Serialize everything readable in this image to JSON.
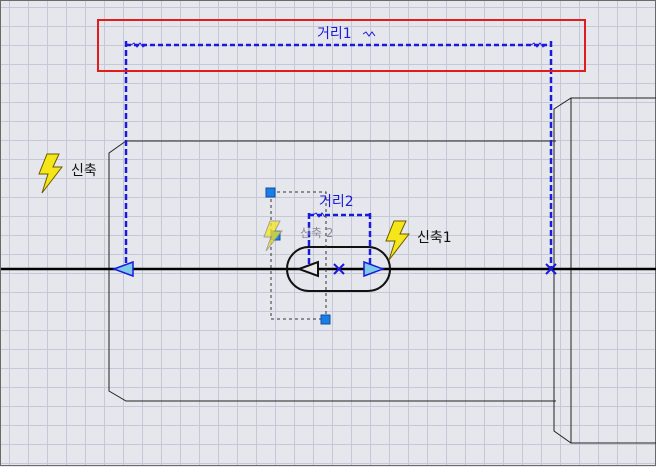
{
  "dimensions": [
    {
      "label": "거리1"
    },
    {
      "label": "거리2"
    }
  ],
  "constraints": [
    {
      "label": "신축"
    },
    {
      "label": "신축1"
    },
    {
      "label": "신축 2"
    }
  ],
  "colors": {
    "background": "#e6e7ec",
    "grid": "#c5c8d6",
    "outline": "#222222",
    "centerline": "#000000",
    "dimension": "#1a1adc",
    "highlight_box": "#e01c1c",
    "handle": "#1a7ee8",
    "arrow_fill": "#7ecbe8",
    "lightning_fill": "#f5e61a",
    "lightning_stroke": "#6b5a00"
  },
  "icons": {
    "constraint": "lightning-bolt-icon",
    "grip": "square-grip-handle",
    "point": "x-mark-icon"
  }
}
